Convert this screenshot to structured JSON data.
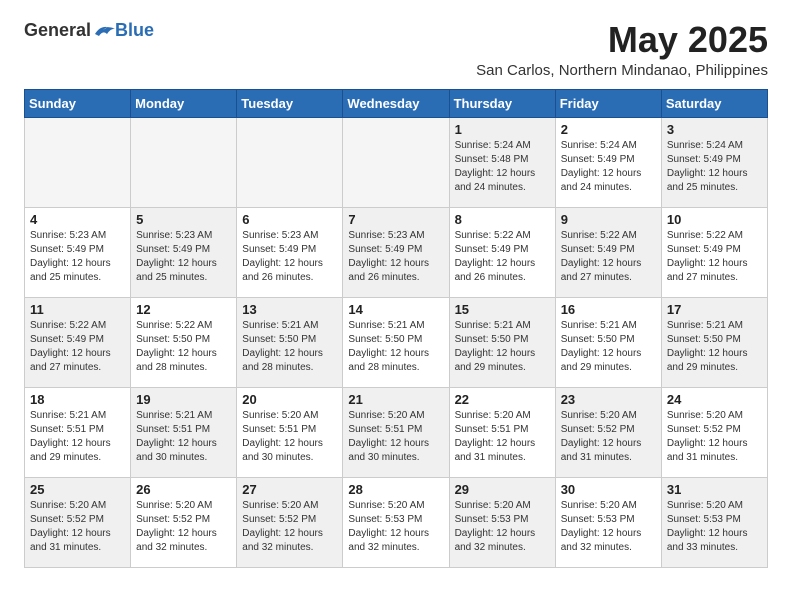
{
  "header": {
    "logo_general": "General",
    "logo_blue": "Blue",
    "month_title": "May 2025",
    "subtitle": "San Carlos, Northern Mindanao, Philippines"
  },
  "days_of_week": [
    "Sunday",
    "Monday",
    "Tuesday",
    "Wednesday",
    "Thursday",
    "Friday",
    "Saturday"
  ],
  "weeks": [
    [
      {
        "day": "",
        "info": "",
        "empty": true
      },
      {
        "day": "",
        "info": "",
        "empty": true
      },
      {
        "day": "",
        "info": "",
        "empty": true
      },
      {
        "day": "",
        "info": "",
        "empty": true
      },
      {
        "day": "1",
        "info": "Sunrise: 5:24 AM\nSunset: 5:48 PM\nDaylight: 12 hours\nand 24 minutes.",
        "shaded": true
      },
      {
        "day": "2",
        "info": "Sunrise: 5:24 AM\nSunset: 5:49 PM\nDaylight: 12 hours\nand 24 minutes.",
        "shaded": false
      },
      {
        "day": "3",
        "info": "Sunrise: 5:24 AM\nSunset: 5:49 PM\nDaylight: 12 hours\nand 25 minutes.",
        "shaded": true
      }
    ],
    [
      {
        "day": "4",
        "info": "Sunrise: 5:23 AM\nSunset: 5:49 PM\nDaylight: 12 hours\nand 25 minutes.",
        "shaded": false
      },
      {
        "day": "5",
        "info": "Sunrise: 5:23 AM\nSunset: 5:49 PM\nDaylight: 12 hours\nand 25 minutes.",
        "shaded": true
      },
      {
        "day": "6",
        "info": "Sunrise: 5:23 AM\nSunset: 5:49 PM\nDaylight: 12 hours\nand 26 minutes.",
        "shaded": false
      },
      {
        "day": "7",
        "info": "Sunrise: 5:23 AM\nSunset: 5:49 PM\nDaylight: 12 hours\nand 26 minutes.",
        "shaded": true
      },
      {
        "day": "8",
        "info": "Sunrise: 5:22 AM\nSunset: 5:49 PM\nDaylight: 12 hours\nand 26 minutes.",
        "shaded": false
      },
      {
        "day": "9",
        "info": "Sunrise: 5:22 AM\nSunset: 5:49 PM\nDaylight: 12 hours\nand 27 minutes.",
        "shaded": true
      },
      {
        "day": "10",
        "info": "Sunrise: 5:22 AM\nSunset: 5:49 PM\nDaylight: 12 hours\nand 27 minutes.",
        "shaded": false
      }
    ],
    [
      {
        "day": "11",
        "info": "Sunrise: 5:22 AM\nSunset: 5:49 PM\nDaylight: 12 hours\nand 27 minutes.",
        "shaded": true
      },
      {
        "day": "12",
        "info": "Sunrise: 5:22 AM\nSunset: 5:50 PM\nDaylight: 12 hours\nand 28 minutes.",
        "shaded": false
      },
      {
        "day": "13",
        "info": "Sunrise: 5:21 AM\nSunset: 5:50 PM\nDaylight: 12 hours\nand 28 minutes.",
        "shaded": true
      },
      {
        "day": "14",
        "info": "Sunrise: 5:21 AM\nSunset: 5:50 PM\nDaylight: 12 hours\nand 28 minutes.",
        "shaded": false
      },
      {
        "day": "15",
        "info": "Sunrise: 5:21 AM\nSunset: 5:50 PM\nDaylight: 12 hours\nand 29 minutes.",
        "shaded": true
      },
      {
        "day": "16",
        "info": "Sunrise: 5:21 AM\nSunset: 5:50 PM\nDaylight: 12 hours\nand 29 minutes.",
        "shaded": false
      },
      {
        "day": "17",
        "info": "Sunrise: 5:21 AM\nSunset: 5:50 PM\nDaylight: 12 hours\nand 29 minutes.",
        "shaded": true
      }
    ],
    [
      {
        "day": "18",
        "info": "Sunrise: 5:21 AM\nSunset: 5:51 PM\nDaylight: 12 hours\nand 29 minutes.",
        "shaded": false
      },
      {
        "day": "19",
        "info": "Sunrise: 5:21 AM\nSunset: 5:51 PM\nDaylight: 12 hours\nand 30 minutes.",
        "shaded": true
      },
      {
        "day": "20",
        "info": "Sunrise: 5:20 AM\nSunset: 5:51 PM\nDaylight: 12 hours\nand 30 minutes.",
        "shaded": false
      },
      {
        "day": "21",
        "info": "Sunrise: 5:20 AM\nSunset: 5:51 PM\nDaylight: 12 hours\nand 30 minutes.",
        "shaded": true
      },
      {
        "day": "22",
        "info": "Sunrise: 5:20 AM\nSunset: 5:51 PM\nDaylight: 12 hours\nand 31 minutes.",
        "shaded": false
      },
      {
        "day": "23",
        "info": "Sunrise: 5:20 AM\nSunset: 5:52 PM\nDaylight: 12 hours\nand 31 minutes.",
        "shaded": true
      },
      {
        "day": "24",
        "info": "Sunrise: 5:20 AM\nSunset: 5:52 PM\nDaylight: 12 hours\nand 31 minutes.",
        "shaded": false
      }
    ],
    [
      {
        "day": "25",
        "info": "Sunrise: 5:20 AM\nSunset: 5:52 PM\nDaylight: 12 hours\nand 31 minutes.",
        "shaded": true
      },
      {
        "day": "26",
        "info": "Sunrise: 5:20 AM\nSunset: 5:52 PM\nDaylight: 12 hours\nand 32 minutes.",
        "shaded": false
      },
      {
        "day": "27",
        "info": "Sunrise: 5:20 AM\nSunset: 5:52 PM\nDaylight: 12 hours\nand 32 minutes.",
        "shaded": true
      },
      {
        "day": "28",
        "info": "Sunrise: 5:20 AM\nSunset: 5:53 PM\nDaylight: 12 hours\nand 32 minutes.",
        "shaded": false
      },
      {
        "day": "29",
        "info": "Sunrise: 5:20 AM\nSunset: 5:53 PM\nDaylight: 12 hours\nand 32 minutes.",
        "shaded": true
      },
      {
        "day": "30",
        "info": "Sunrise: 5:20 AM\nSunset: 5:53 PM\nDaylight: 12 hours\nand 32 minutes.",
        "shaded": false
      },
      {
        "day": "31",
        "info": "Sunrise: 5:20 AM\nSunset: 5:53 PM\nDaylight: 12 hours\nand 33 minutes.",
        "shaded": true
      }
    ]
  ]
}
